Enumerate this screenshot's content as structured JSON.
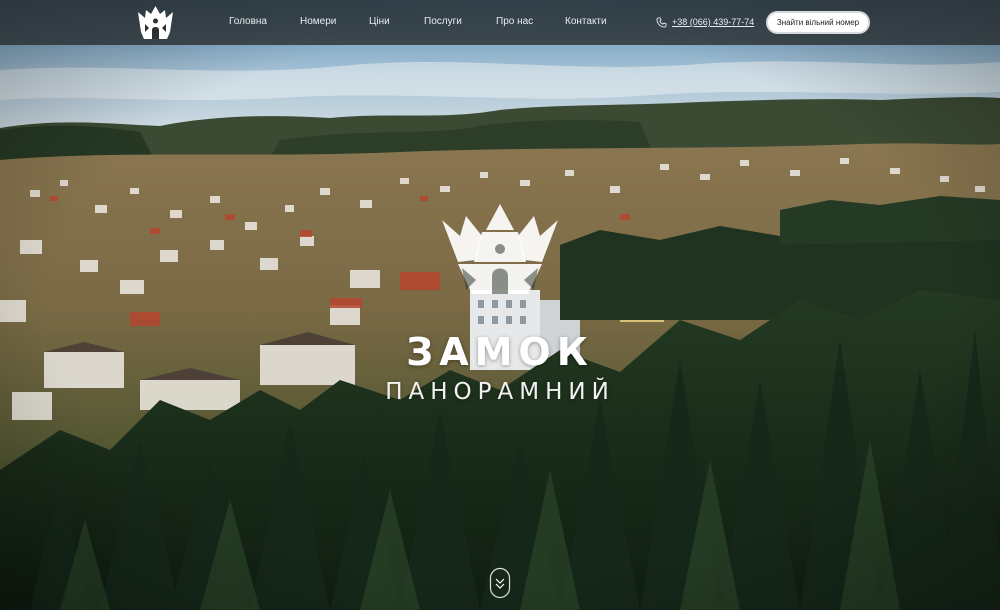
{
  "header": {
    "logo_icon": "castle-crown-logo-icon",
    "nav": [
      {
        "label": "Головна"
      },
      {
        "label": "Номери"
      },
      {
        "label": "Ціни"
      },
      {
        "label": "Послуги"
      },
      {
        "label": "Про нас"
      },
      {
        "label": "Контакти"
      }
    ],
    "phone": {
      "icon": "phone-icon",
      "number": "+38 (066) 439-77-74"
    },
    "cta_label": "Знайти вільний номер"
  },
  "hero": {
    "logo_icon": "castle-crown-logo-icon",
    "title": "ЗАМОК",
    "subtitle": "ПАНОРАМНИЙ",
    "scroll_icon": "scroll-down-chevron-icon"
  },
  "colors": {
    "header_bg": "#262a2c",
    "nav_text": "#e7ecef",
    "cta_bg": "#ffffff",
    "cta_text": "#1d1d1d",
    "brand_text": "#ffffff"
  }
}
